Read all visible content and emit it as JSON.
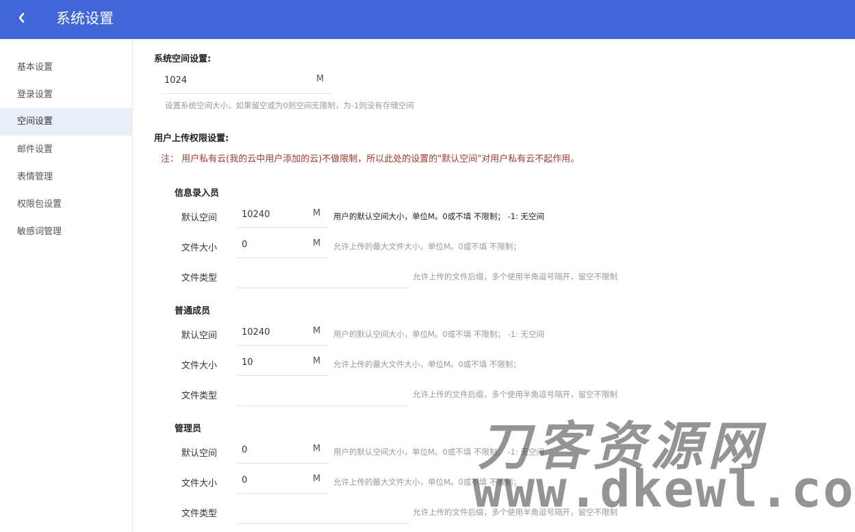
{
  "header": {
    "title": "系统设置"
  },
  "sidebar": {
    "items": [
      {
        "label": "基本设置",
        "active": false
      },
      {
        "label": "登录设置",
        "active": false
      },
      {
        "label": "空间设置",
        "active": true
      },
      {
        "label": "邮件设置",
        "active": false
      },
      {
        "label": "表情管理",
        "active": false
      },
      {
        "label": "权限包设置",
        "active": false
      },
      {
        "label": "敏感词管理",
        "active": false
      }
    ]
  },
  "system_space": {
    "title": "系统空间设置:",
    "value": "1024",
    "unit": "M",
    "hint": "设置系统空间大小，如果留空或为0则空间无限制，为-1则没有存储空间"
  },
  "upload": {
    "title": "用户上传权限设置:",
    "note": "注： 用户私有云(我的云中用户添加的云)不做限制，所以此处的设置的\"默认空间\"对用户私有云不起作用。",
    "groups": [
      {
        "name": "信息录入员",
        "default_space": {
          "label": "默认空间",
          "value": "10240",
          "unit": "M",
          "hint": "用户的默认空间大小，单位M。0或不填 不限制； -1: 无空间"
        },
        "file_size": {
          "label": "文件大小",
          "value": "0",
          "unit": "M",
          "hint": "允许上传的最大文件大小，单位M。0或不填 不限制；"
        },
        "file_type": {
          "label": "文件类型",
          "value": "",
          "hint": "允许上传的文件后缀，多个使用半角逗号隔开，留空不限制"
        }
      },
      {
        "name": "普通成员",
        "default_space": {
          "label": "默认空间",
          "value": "10240",
          "unit": "M",
          "hint": "用户的默认空间大小，单位M。0或不填 不限制； -1: 无空间"
        },
        "file_size": {
          "label": "文件大小",
          "value": "10",
          "unit": "M",
          "hint": "允许上传的最大文件大小，单位M。0或不填 不限制；"
        },
        "file_type": {
          "label": "文件类型",
          "value": "",
          "hint": "允许上传的文件后缀，多个使用半角逗号隔开，留空不限制"
        }
      },
      {
        "name": "管理员",
        "default_space": {
          "label": "默认空间",
          "value": "0",
          "unit": "M",
          "hint": "用户的默认空间大小，单位M。0或不填 不限制； -1: 无空间"
        },
        "file_size": {
          "label": "文件大小",
          "value": "0",
          "unit": "M",
          "hint": "允许上传的最大文件大小，单位M。0或不填 不限制；"
        },
        "file_type": {
          "label": "文件类型",
          "value": "",
          "hint": "允许上传的文件后缀，多个使用半角逗号隔开，留空不限制"
        }
      }
    ]
  },
  "watermark": {
    "cn": "刀客资源网",
    "en": "www.dkewl.com"
  },
  "colors": {
    "header_bg": "#4166d8",
    "active_nav_bg": "#e9eefb",
    "note_text": "#a33a2f"
  }
}
